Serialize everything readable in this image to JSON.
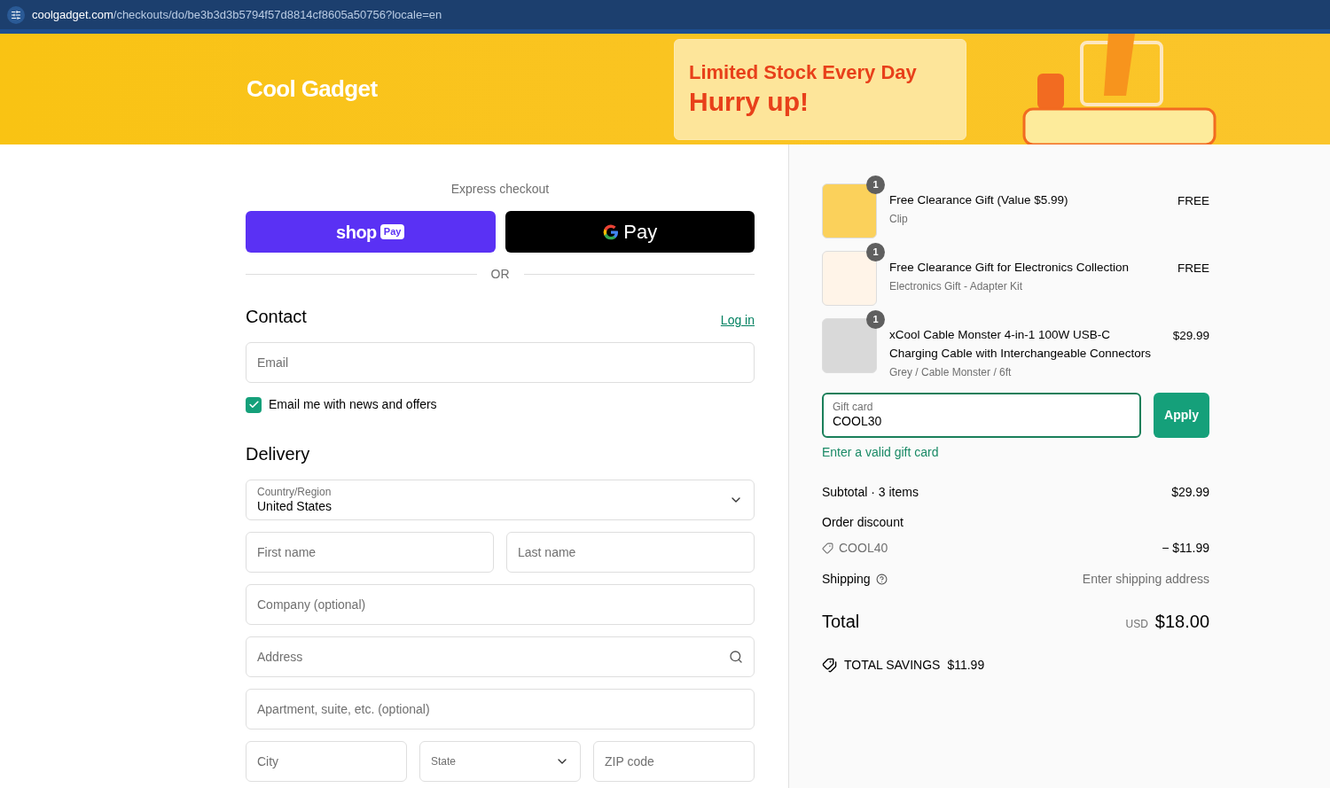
{
  "browser": {
    "url_domain": "coolgadget.com",
    "url_path": "/checkouts/do/be3b3d3b5794f57d8814cf8605a50756?locale=en"
  },
  "banner": {
    "logo": "Cool Gadget",
    "headline": "Limited Stock Every Day",
    "subheadline": "Hurry up!"
  },
  "express": {
    "title": "Express checkout",
    "buttons": [
      {
        "kind": "shop_pay",
        "wordmark": "shop",
        "badge": "Pay"
      },
      {
        "kind": "google_pay",
        "wordmark": "Pay"
      }
    ],
    "divider": "OR"
  },
  "contact": {
    "title": "Contact",
    "login": "Log in",
    "email_placeholder": "Email",
    "newsletter": {
      "label": "Email me with news and offers",
      "checked": true
    }
  },
  "delivery": {
    "title": "Delivery",
    "rows": [
      [
        {
          "kind": "select",
          "label": "Country/Region",
          "value": "United States"
        }
      ],
      [
        {
          "kind": "text",
          "placeholder": "First name"
        },
        {
          "kind": "text",
          "placeholder": "Last name"
        }
      ],
      [
        {
          "kind": "text",
          "placeholder": "Company (optional)"
        }
      ],
      [
        {
          "kind": "search",
          "placeholder": "Address"
        }
      ],
      [
        {
          "kind": "text",
          "placeholder": "Apartment, suite, etc. (optional)"
        }
      ],
      [
        {
          "kind": "text",
          "placeholder": "City"
        },
        {
          "kind": "select",
          "label": "State"
        },
        {
          "kind": "text",
          "placeholder": "ZIP code"
        }
      ]
    ]
  },
  "summary": {
    "items": [
      {
        "quantity": "1",
        "name": "Free Clearance Gift (Value $5.99)",
        "variant": "Clip",
        "price": "FREE"
      },
      {
        "quantity": "1",
        "name": "Free Clearance Gift for Electronics Collection",
        "variant": "Electronics Gift - Adapter Kit",
        "price": "FREE"
      },
      {
        "quantity": "1",
        "name": "xCool Cable Monster 4-in-1 100W USB-C Charging Cable with Interchangeable Connectors",
        "variant": "Grey / Cable Monster / 6ft",
        "price": "$29.99"
      }
    ],
    "gift_card": {
      "label": "Gift card",
      "value": "COOL30",
      "button": "Apply",
      "error": "Enter a valid gift card"
    },
    "subtotal": {
      "label": "Subtotal",
      "separator": "·",
      "count": "3 items",
      "value": "$29.99"
    },
    "discount": {
      "label": "Order discount",
      "code": "COOL40",
      "value": "− $11.99"
    },
    "shipping": {
      "label": "Shipping",
      "value": "Enter shipping address"
    },
    "total": {
      "label": "Total",
      "currency": "USD",
      "value": "$18.00"
    },
    "savings": {
      "label": "TOTAL SAVINGS",
      "value": "$11.99"
    }
  }
}
